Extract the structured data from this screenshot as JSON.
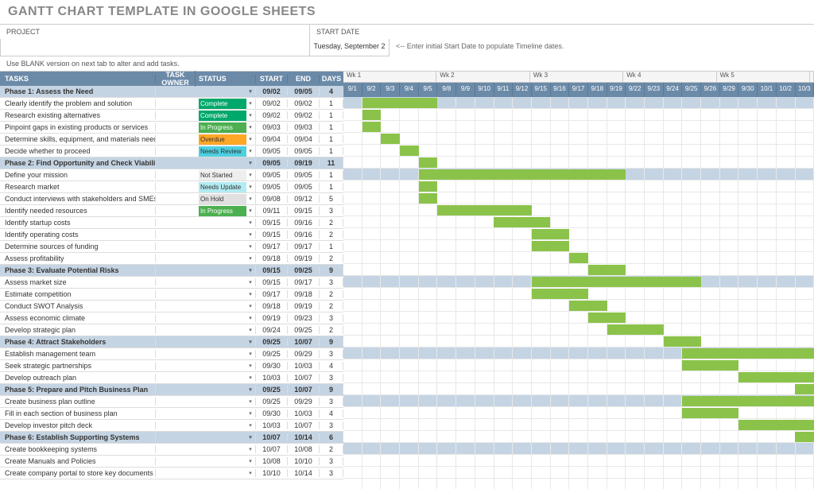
{
  "title": "GANTT CHART TEMPLATE IN GOOGLE SHEETS",
  "labels": {
    "project": "PROJECT",
    "start_date": "START DATE",
    "hint": "<-- Enter initial Start Date to populate Timeline dates.",
    "note": "Use BLANK version on next tab to alter and add tasks."
  },
  "inputs": {
    "project": "",
    "start_date": "Tuesday, September 2"
  },
  "columns": {
    "tasks": "TASKS",
    "owner": "TASK OWNER",
    "status": "STATUS",
    "start": "START",
    "end": "END",
    "days": "DAYS"
  },
  "weeks": [
    "Wk 1",
    "Wk 2",
    "Wk 3",
    "Wk 4",
    "Wk 5",
    ""
  ],
  "days": [
    "9/1",
    "9/2",
    "9/3",
    "9/4",
    "9/5",
    "9/8",
    "9/9",
    "9/10",
    "9/11",
    "9/12",
    "9/15",
    "9/16",
    "9/17",
    "9/18",
    "9/19",
    "9/22",
    "9/23",
    "9/24",
    "9/25",
    "9/26",
    "9/29",
    "9/30",
    "10/1",
    "10/2",
    "10/3"
  ],
  "rows": [
    {
      "type": "phase",
      "task": "Phase 1: Assess the Need",
      "status": "",
      "start": "09/02",
      "end": "09/05",
      "days": "4",
      "bar_start": 1,
      "bar_len": 4
    },
    {
      "type": "task",
      "task": "Clearly identify the problem and solution",
      "status": "Complete",
      "start": "09/02",
      "end": "09/02",
      "days": "1",
      "bar_start": 1,
      "bar_len": 1
    },
    {
      "type": "task",
      "task": "Research existing alternatives",
      "status": "Complete",
      "start": "09/02",
      "end": "09/02",
      "days": "1",
      "bar_start": 1,
      "bar_len": 1
    },
    {
      "type": "task",
      "task": "Pinpoint gaps in existing products or services",
      "status": "In Progress",
      "start": "09/03",
      "end": "09/03",
      "days": "1",
      "bar_start": 2,
      "bar_len": 1
    },
    {
      "type": "task",
      "task": "Determine skills, equipment, and materials needed",
      "status": "Overdue",
      "start": "09/04",
      "end": "09/04",
      "days": "1",
      "bar_start": 3,
      "bar_len": 1
    },
    {
      "type": "task",
      "task": "Decide whether to proceed",
      "status": "Needs Review",
      "start": "09/05",
      "end": "09/05",
      "days": "1",
      "bar_start": 4,
      "bar_len": 1
    },
    {
      "type": "phase",
      "task": "Phase 2: Find Opportunity and Check Viability",
      "status": "",
      "start": "09/05",
      "end": "09/19",
      "days": "11",
      "bar_start": 4,
      "bar_len": 11
    },
    {
      "type": "task",
      "task": "Define your mission",
      "status": "Not Started",
      "start": "09/05",
      "end": "09/05",
      "days": "1",
      "bar_start": 4,
      "bar_len": 1
    },
    {
      "type": "task",
      "task": "Research market",
      "status": "Needs Update",
      "start": "09/05",
      "end": "09/05",
      "days": "1",
      "bar_start": 4,
      "bar_len": 1
    },
    {
      "type": "task",
      "task": "Conduct interviews with stakeholders and SMEs",
      "status": "On Hold",
      "start": "09/08",
      "end": "09/12",
      "days": "5",
      "bar_start": 5,
      "bar_len": 5
    },
    {
      "type": "task",
      "task": "Identify needed resources",
      "status": "In Progress",
      "start": "09/11",
      "end": "09/15",
      "days": "3",
      "bar_start": 8,
      "bar_len": 3
    },
    {
      "type": "task",
      "task": "Identify startup costs",
      "status": "",
      "start": "09/15",
      "end": "09/16",
      "days": "2",
      "bar_start": 10,
      "bar_len": 2
    },
    {
      "type": "task",
      "task": "Identify operating costs",
      "status": "",
      "start": "09/15",
      "end": "09/16",
      "days": "2",
      "bar_start": 10,
      "bar_len": 2
    },
    {
      "type": "task",
      "task": "Determine sources of funding",
      "status": "",
      "start": "09/17",
      "end": "09/17",
      "days": "1",
      "bar_start": 12,
      "bar_len": 1
    },
    {
      "type": "task",
      "task": "Assess profitability",
      "status": "",
      "start": "09/18",
      "end": "09/19",
      "days": "2",
      "bar_start": 13,
      "bar_len": 2
    },
    {
      "type": "phase",
      "task": "Phase 3: Evaluate Potential Risks",
      "status": "",
      "start": "09/15",
      "end": "09/25",
      "days": "9",
      "bar_start": 10,
      "bar_len": 9
    },
    {
      "type": "task",
      "task": "Assess market size",
      "status": "",
      "start": "09/15",
      "end": "09/17",
      "days": "3",
      "bar_start": 10,
      "bar_len": 3
    },
    {
      "type": "task",
      "task": "Estimate competition",
      "status": "",
      "start": "09/17",
      "end": "09/18",
      "days": "2",
      "bar_start": 12,
      "bar_len": 2
    },
    {
      "type": "task",
      "task": "Conduct SWOT Analysis",
      "status": "",
      "start": "09/18",
      "end": "09/19",
      "days": "2",
      "bar_start": 13,
      "bar_len": 2
    },
    {
      "type": "task",
      "task": "Assess economic climate",
      "status": "",
      "start": "09/19",
      "end": "09/23",
      "days": "3",
      "bar_start": 14,
      "bar_len": 3
    },
    {
      "type": "task",
      "task": "Develop strategic plan",
      "status": "",
      "start": "09/24",
      "end": "09/25",
      "days": "2",
      "bar_start": 17,
      "bar_len": 2
    },
    {
      "type": "phase",
      "task": "Phase 4: Attract Stakeholders",
      "status": "",
      "start": "09/25",
      "end": "10/07",
      "days": "9",
      "bar_start": 18,
      "bar_len": 7
    },
    {
      "type": "task",
      "task": "Establish management team",
      "status": "",
      "start": "09/25",
      "end": "09/29",
      "days": "3",
      "bar_start": 18,
      "bar_len": 3
    },
    {
      "type": "task",
      "task": "Seek strategic partnerships",
      "status": "",
      "start": "09/30",
      "end": "10/03",
      "days": "4",
      "bar_start": 21,
      "bar_len": 4
    },
    {
      "type": "task",
      "task": "Develop outreach plan",
      "status": "",
      "start": "10/03",
      "end": "10/07",
      "days": "3",
      "bar_start": 24,
      "bar_len": 1
    },
    {
      "type": "phase",
      "task": "Phase 5: Prepare and Pitch Business Plan",
      "status": "",
      "start": "09/25",
      "end": "10/07",
      "days": "9",
      "bar_start": 18,
      "bar_len": 7
    },
    {
      "type": "task",
      "task": "Create business plan outline",
      "status": "",
      "start": "09/25",
      "end": "09/29",
      "days": "3",
      "bar_start": 18,
      "bar_len": 3
    },
    {
      "type": "task",
      "task": "Fill in each section of business plan",
      "status": "",
      "start": "09/30",
      "end": "10/03",
      "days": "4",
      "bar_start": 21,
      "bar_len": 4
    },
    {
      "type": "task",
      "task": "Develop investor pitch deck",
      "status": "",
      "start": "10/03",
      "end": "10/07",
      "days": "3",
      "bar_start": 24,
      "bar_len": 1
    },
    {
      "type": "phase",
      "task": "Phase 6: Establish Supporting Systems",
      "status": "",
      "start": "10/07",
      "end": "10/14",
      "days": "6",
      "bar_start": 25,
      "bar_len": 0
    },
    {
      "type": "task",
      "task": "Create bookkeeping systems",
      "status": "",
      "start": "10/07",
      "end": "10/08",
      "days": "2",
      "bar_start": 25,
      "bar_len": 0
    },
    {
      "type": "task",
      "task": "Create Manuals and Policies",
      "status": "",
      "start": "10/08",
      "end": "10/10",
      "days": "3",
      "bar_start": 25,
      "bar_len": 0
    },
    {
      "type": "task",
      "task": "Create company portal to store key documents",
      "status": "",
      "start": "10/10",
      "end": "10/14",
      "days": "3",
      "bar_start": 25,
      "bar_len": 0
    }
  ],
  "chart_data": {
    "type": "gantt",
    "title": "Gantt Chart Template",
    "x_axis": "Dates (Sep 1 – Oct 3, weekdays)",
    "tasks": [
      {
        "name": "Phase 1: Assess the Need",
        "start": "09/02",
        "end": "09/05",
        "duration": 4,
        "phase": true
      },
      {
        "name": "Clearly identify the problem and solution",
        "start": "09/02",
        "end": "09/02",
        "duration": 1,
        "status": "Complete"
      },
      {
        "name": "Research existing alternatives",
        "start": "09/02",
        "end": "09/02",
        "duration": 1,
        "status": "Complete"
      },
      {
        "name": "Pinpoint gaps in existing products or services",
        "start": "09/03",
        "end": "09/03",
        "duration": 1,
        "status": "In Progress"
      },
      {
        "name": "Determine skills, equipment, and materials needed",
        "start": "09/04",
        "end": "09/04",
        "duration": 1,
        "status": "Overdue"
      },
      {
        "name": "Decide whether to proceed",
        "start": "09/05",
        "end": "09/05",
        "duration": 1,
        "status": "Needs Review"
      },
      {
        "name": "Phase 2: Find Opportunity and Check Viability",
        "start": "09/05",
        "end": "09/19",
        "duration": 11,
        "phase": true
      },
      {
        "name": "Define your mission",
        "start": "09/05",
        "end": "09/05",
        "duration": 1,
        "status": "Not Started"
      },
      {
        "name": "Research market",
        "start": "09/05",
        "end": "09/05",
        "duration": 1,
        "status": "Needs Update"
      },
      {
        "name": "Conduct interviews with stakeholders and SMEs",
        "start": "09/08",
        "end": "09/12",
        "duration": 5,
        "status": "On Hold"
      },
      {
        "name": "Identify needed resources",
        "start": "09/11",
        "end": "09/15",
        "duration": 3,
        "status": "In Progress"
      },
      {
        "name": "Identify startup costs",
        "start": "09/15",
        "end": "09/16",
        "duration": 2
      },
      {
        "name": "Identify operating costs",
        "start": "09/15",
        "end": "09/16",
        "duration": 2
      },
      {
        "name": "Determine sources of funding",
        "start": "09/17",
        "end": "09/17",
        "duration": 1
      },
      {
        "name": "Assess profitability",
        "start": "09/18",
        "end": "09/19",
        "duration": 2
      },
      {
        "name": "Phase 3: Evaluate Potential Risks",
        "start": "09/15",
        "end": "09/25",
        "duration": 9,
        "phase": true
      },
      {
        "name": "Assess market size",
        "start": "09/15",
        "end": "09/17",
        "duration": 3
      },
      {
        "name": "Estimate competition",
        "start": "09/17",
        "end": "09/18",
        "duration": 2
      },
      {
        "name": "Conduct SWOT Analysis",
        "start": "09/18",
        "end": "09/19",
        "duration": 2
      },
      {
        "name": "Assess economic climate",
        "start": "09/19",
        "end": "09/23",
        "duration": 3
      },
      {
        "name": "Develop strategic plan",
        "start": "09/24",
        "end": "09/25",
        "duration": 2
      },
      {
        "name": "Phase 4: Attract Stakeholders",
        "start": "09/25",
        "end": "10/07",
        "duration": 9,
        "phase": true
      },
      {
        "name": "Establish management team",
        "start": "09/25",
        "end": "09/29",
        "duration": 3
      },
      {
        "name": "Seek strategic partnerships",
        "start": "09/30",
        "end": "10/03",
        "duration": 4
      },
      {
        "name": "Develop outreach plan",
        "start": "10/03",
        "end": "10/07",
        "duration": 3
      },
      {
        "name": "Phase 5: Prepare and Pitch Business Plan",
        "start": "09/25",
        "end": "10/07",
        "duration": 9,
        "phase": true
      },
      {
        "name": "Create business plan outline",
        "start": "09/25",
        "end": "09/29",
        "duration": 3
      },
      {
        "name": "Fill in each section of business plan",
        "start": "09/30",
        "end": "10/03",
        "duration": 4
      },
      {
        "name": "Develop investor pitch deck",
        "start": "10/03",
        "end": "10/07",
        "duration": 3
      },
      {
        "name": "Phase 6: Establish Supporting Systems",
        "start": "10/07",
        "end": "10/14",
        "duration": 6,
        "phase": true
      },
      {
        "name": "Create bookkeeping systems",
        "start": "10/07",
        "end": "10/08",
        "duration": 2
      },
      {
        "name": "Create Manuals and Policies",
        "start": "10/08",
        "end": "10/10",
        "duration": 3
      },
      {
        "name": "Create company portal to store key documents",
        "start": "10/10",
        "end": "10/14",
        "duration": 3
      }
    ]
  }
}
